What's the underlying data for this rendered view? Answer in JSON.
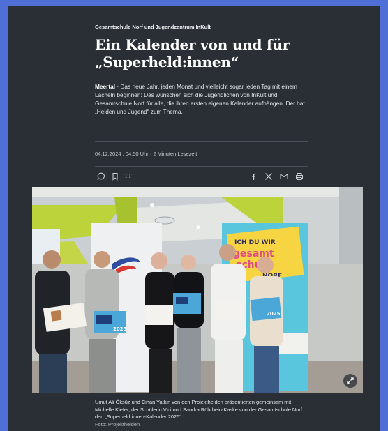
{
  "article": {
    "kicker": "Gesamtschule Norf und Jugendzentrum InKult",
    "title_line1": "Ein Kalender von und für",
    "title_line2": "„Superheld:innen“",
    "lead_location": "Meertal",
    "lead_text": " · Das neue Jahr, jeden Monat und vielleicht sogar jeden Tag mit einem Lächeln beginnen: Das wünschen sich die Jugendlichen von InKult und Gesamtschule Norf für alle, die ihren ersten eigenen Kalender aufhängen. Der hat „Helden und Jugend“ zum Thema.",
    "meta": "04.12.2024 , 04:50 Uhr · 2 Minuten Lesezeit"
  },
  "toolbar": {
    "left_icons": [
      "comment-icon",
      "bookmark-icon",
      "text-size-icon"
    ],
    "right_icons": [
      "facebook-icon",
      "x-icon",
      "mail-icon",
      "print-icon"
    ],
    "text_size_label": "TT"
  },
  "photo": {
    "banner_text_1": "ICH DU WIR",
    "banner_text_2": "gesamt",
    "banner_text_3": "schule",
    "banner_text_4": "NORF",
    "calendar_label": "2025",
    "expand_icon": "expand-icon"
  },
  "caption": {
    "text": "Umut Ali Öksüz und Cihan Yatkin von den Projekthelden präsentierten gemeinsam mit Michelle Kiefer, der Schülerin Vici und Sandra Röhrbein-Kaske von der Gesamtschule Norf den „Superheld:innen-Kalender 2025“.",
    "credit": "Foto: Projekthelden"
  },
  "colors": {
    "page_bg": "#4f6fd6",
    "panel_bg": "#2a2f36",
    "ceiling_green": "#b8d23a"
  }
}
